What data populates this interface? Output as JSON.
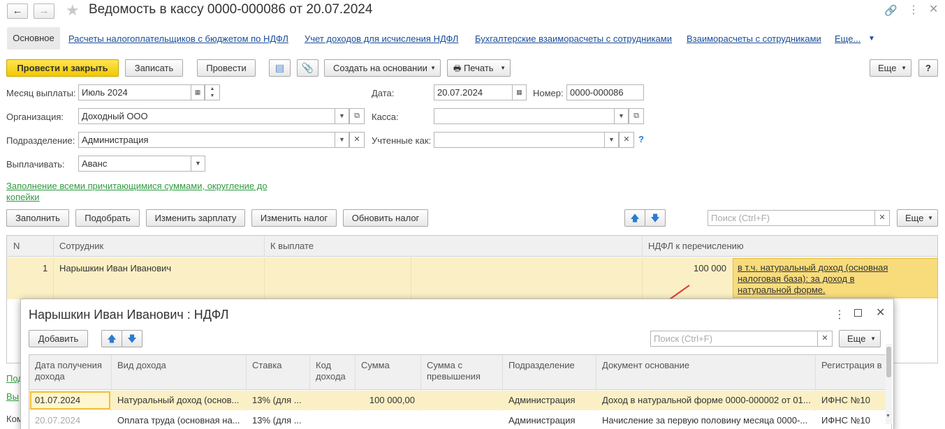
{
  "header": {
    "title": "Ведомость в кассу 0000-000086 от 20.07.2024"
  },
  "tabs": {
    "main": "Основное",
    "links": [
      "Расчеты налогоплательщиков с бюджетом по НДФЛ",
      "Учет доходов для исчисления НДФЛ",
      "Бухгалтерские взаиморасчеты с сотрудниками",
      "Взаиморасчеты с сотрудниками",
      "Еще..."
    ]
  },
  "toolbar": {
    "post_close": "Провести и закрыть",
    "save": "Записать",
    "post": "Провести",
    "create_based": "Создать на основании",
    "print": "Печать",
    "more": "Еще",
    "help": "?"
  },
  "form": {
    "month_label": "Месяц выплаты:",
    "month_value": "Июль 2024",
    "date_label": "Дата:",
    "date_value": "20.07.2024",
    "number_label": "Номер:",
    "number_value": "0000-000086",
    "org_label": "Организация:",
    "org_value": "Доходный ООО",
    "kassa_label": "Касса:",
    "kassa_value": "",
    "dept_label": "Подразделение:",
    "dept_value": "Администрация",
    "accounted_label": "Учтенные как:",
    "accounted_value": "",
    "pay_label": "Выплачивать:",
    "pay_value": "Аванс",
    "fill_link": "Заполнение всеми причитающимися суммами, округление до копейки"
  },
  "table_toolbar": {
    "fill": "Заполнить",
    "select": "Подобрать",
    "change_salary": "Изменить зарплату",
    "change_tax": "Изменить налог",
    "refresh_tax": "Обновить налог",
    "search_placeholder": "Поиск (Ctrl+F)",
    "more": "Еще"
  },
  "main_table": {
    "columns": [
      "N",
      "Сотрудник",
      "К выплате",
      "НДФЛ к перечислению"
    ],
    "rows": [
      {
        "n": "1",
        "employee": "Нарышкин Иван Иванович",
        "to_pay": "",
        "ndfl": "100 000",
        "note": "в т.ч. натуральный доход (основная налоговая база): за доход в натуральной форме."
      }
    ]
  },
  "bottom_partial": {
    "line1": "Под",
    "line2": "Вы",
    "line3": "Ком"
  },
  "popup": {
    "title": "Нарышкин Иван Иванович : НДФЛ",
    "add": "Добавить",
    "search_placeholder": "Поиск (Ctrl+F)",
    "more": "Еще",
    "columns": [
      "Дата получения дохода",
      "Вид дохода",
      "Ставка",
      "Код дохода",
      "Сумма",
      "Сумма с превышения",
      "Подразделение",
      "Документ основание",
      "Регистрация в"
    ],
    "rows": [
      {
        "date": "01.07.2024",
        "type": "Натуральный доход (основ...",
        "rate": "13% (для ...",
        "code": "",
        "sum": "100 000,00",
        "excess": "",
        "dept": "Администрация",
        "doc": "Доход в натуральной форме 0000-000002 от 01....",
        "reg": "ИФНС №10"
      },
      {
        "date": "20.07.2024",
        "type": "Оплата труда (основная на...",
        "rate": "13% (для ...",
        "code": "",
        "sum": "",
        "excess": "",
        "dept": "Администрация",
        "doc": "Начисление за первую половину месяца 0000-...",
        "reg": "ИФНС №10"
      }
    ]
  },
  "colors": {
    "accent_yellow": "#f5d400",
    "row_highlight": "#fbf0c5",
    "link_blue": "#1a4d99",
    "link_green": "#2f9a41",
    "arrow_red": "#e03a3a"
  }
}
